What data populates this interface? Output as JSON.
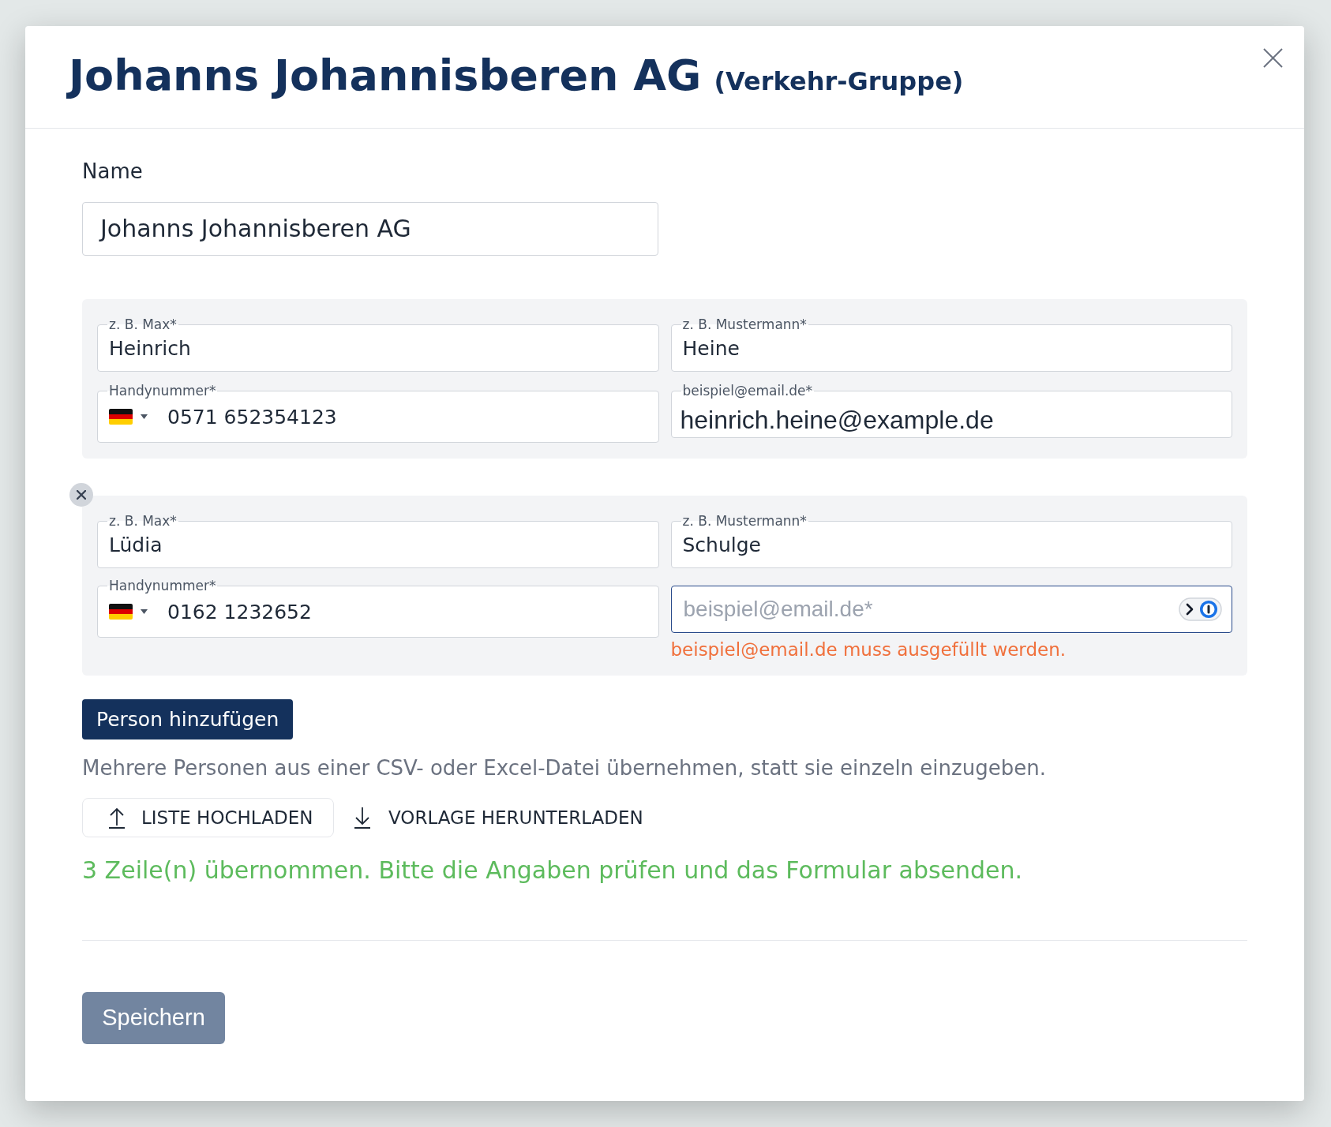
{
  "dialog": {
    "title": "Johanns Johannisberen AG",
    "subtitle": "(Verkehr-Gruppe)"
  },
  "name_field": {
    "label": "Name",
    "value": "Johanns Johannisberen AG"
  },
  "persons": [
    {
      "removable": false,
      "first_name": {
        "label": "z. B. Max*",
        "value": "Heinrich"
      },
      "last_name": {
        "label": "z. B. Mustermann*",
        "value": "Heine"
      },
      "phone": {
        "label": "Handynummer*",
        "value": "0571 652354123"
      },
      "email": {
        "label": "beispiel@email.de*",
        "value": "heinrich.heine@example.de",
        "autofilled": true,
        "focused": false,
        "autofill_badge": false
      }
    },
    {
      "removable": true,
      "first_name": {
        "label": "z. B. Max*",
        "value": "Lüdia"
      },
      "last_name": {
        "label": "z. B. Mustermann*",
        "value": "Schulge"
      },
      "phone": {
        "label": "Handynummer*",
        "value": "0162 1232652"
      },
      "email": {
        "placeholder": "beispiel@email.de*",
        "autofilled": false,
        "focused": true,
        "autofill_badge": true,
        "error": "beispiel@email.de muss ausgefüllt werden."
      }
    }
  ],
  "add_person_button": "Person hinzufügen",
  "import": {
    "hint": "Mehrere Personen aus einer CSV- oder Excel-Datei übernehmen, statt sie einzeln einzugeben.",
    "upload_button": "LISTE HOCHLADEN",
    "template_link": "VORLAGE HERUNTERLADEN",
    "status": {
      "kind": "success",
      "text": "3 Zeile(n) übernommen. Bitte die Angaben prüfen und das Formular absenden."
    }
  },
  "save_button": {
    "label": "Speichern",
    "disabled": true
  }
}
